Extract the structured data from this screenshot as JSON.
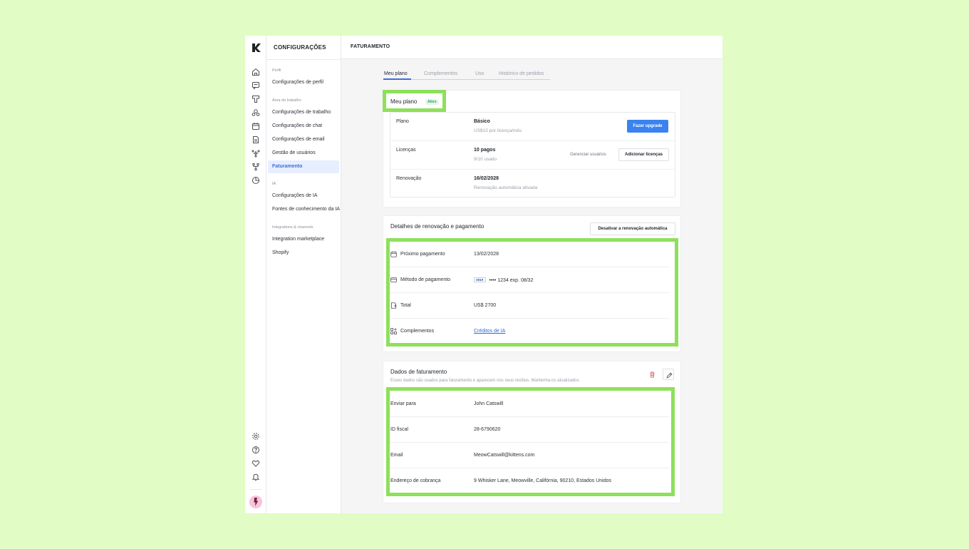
{
  "colors": {
    "accent": "#3d6fd8",
    "highlight": "#8ee05a",
    "primary_button": "#3b82f0",
    "active_badge": "#2f9e5b"
  },
  "rail": {
    "logo": "k-logo-icon",
    "icons_top": [
      "home-icon",
      "chat-icon",
      "board-icon",
      "contacts-icon",
      "calendar-icon",
      "document-icon",
      "sparkle-network-icon",
      "flow-icon",
      "reports-icon"
    ],
    "icons_bottom": [
      "settings-icon",
      "help-icon",
      "heart-icon",
      "bell-icon"
    ]
  },
  "nav": {
    "title": "CONFIGURAÇÕES",
    "groups": [
      {
        "label": "Perfil",
        "items": [
          "Configurações de perfil"
        ]
      },
      {
        "label": "Área de trabalho",
        "items": [
          "Configurações de trabalho",
          "Configurações de chat",
          "Configurações de email",
          "Gestão de usuários",
          "Faturamento"
        ]
      },
      {
        "label": "IA",
        "items": [
          "Configurações de IA",
          "Fontes de conhecimento da IA"
        ]
      },
      {
        "label": "Integrations & channels",
        "items": [
          "Integration marketplace",
          "Shopify"
        ]
      }
    ],
    "active_item": "Faturamento"
  },
  "main": {
    "title": "FATURAMENTO",
    "tabs": [
      "Meu plano",
      "Complementos",
      "Uso",
      "Histórico de pedidos"
    ],
    "active_tab": "Meu plano"
  },
  "plan": {
    "title": "Meu plano",
    "badge": "Ativo",
    "rows": {
      "plano": {
        "label": "Plano",
        "value": "Básico",
        "sub": "US$15 por licença/mês",
        "button": "Fazer upgrade"
      },
      "licencas": {
        "label": "Licenças",
        "value": "10 pagos",
        "sub": "9/10 usado",
        "link": "Gerenciar usuários",
        "button": "Adicionar licenças"
      },
      "renovacao": {
        "label": "Renovação",
        "value": "16/02/2028",
        "sub": "Renovação automática ativada"
      }
    }
  },
  "renewal": {
    "title": "Detalhes de renovação e pagamento",
    "button": "Desativar a renovação automática",
    "rows": {
      "next": {
        "icon": "calendar-icon",
        "label": "Próximo pagamento",
        "value": "13/02/2028"
      },
      "method": {
        "icon": "credit-card-icon",
        "label": "Método de pagamento",
        "card_brand": "VISA",
        "value": "•••• 1234  exp. 08/32"
      },
      "total": {
        "icon": "receipt-icon",
        "label": "Total",
        "value": "US$ 2700"
      },
      "addons": {
        "icon": "apps-add-icon",
        "label": "Complementos",
        "value": "Créditos de IA"
      }
    }
  },
  "billing": {
    "title": "Dados de faturamento",
    "description": "Esses dados são usados para faturamento e aparecem nos seus recibos. Mantenha-os atualizados.",
    "rows": {
      "ship": {
        "label": "Enviar para",
        "value": "John Catswill"
      },
      "tax": {
        "label": "ID fiscal",
        "value": "28-6790620"
      },
      "email": {
        "label": "Email",
        "value": "MeowCatswill@kittens.com"
      },
      "address": {
        "label": "Endereço de cobrança",
        "value": "9 Whisker Lane, Meowville, Califórnia, 90210, Estados Unidos"
      }
    }
  }
}
